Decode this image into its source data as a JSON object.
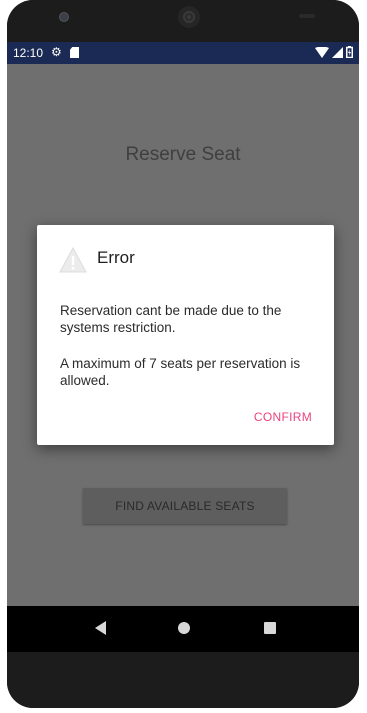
{
  "status_bar": {
    "time": "12:10",
    "icons": [
      "gear-icon",
      "sd-card-icon",
      "wifi-icon",
      "signal-icon",
      "battery-icon"
    ],
    "background_color": "#1b2a55"
  },
  "app": {
    "title": "Reserve Seat",
    "find_button_label": "FIND AVAILABLE SEATS"
  },
  "dialog": {
    "icon": "warning-icon",
    "title": "Error",
    "message_line1": "Reservation cant be made due to the systems restriction.",
    "message_line2": "A maximum of 7 seats per reservation is allowed.",
    "confirm_label": "CONFIRM",
    "accent_color": "#e8437f"
  },
  "nav_bar": {
    "icons": [
      "back-icon",
      "home-icon",
      "recents-icon"
    ]
  }
}
